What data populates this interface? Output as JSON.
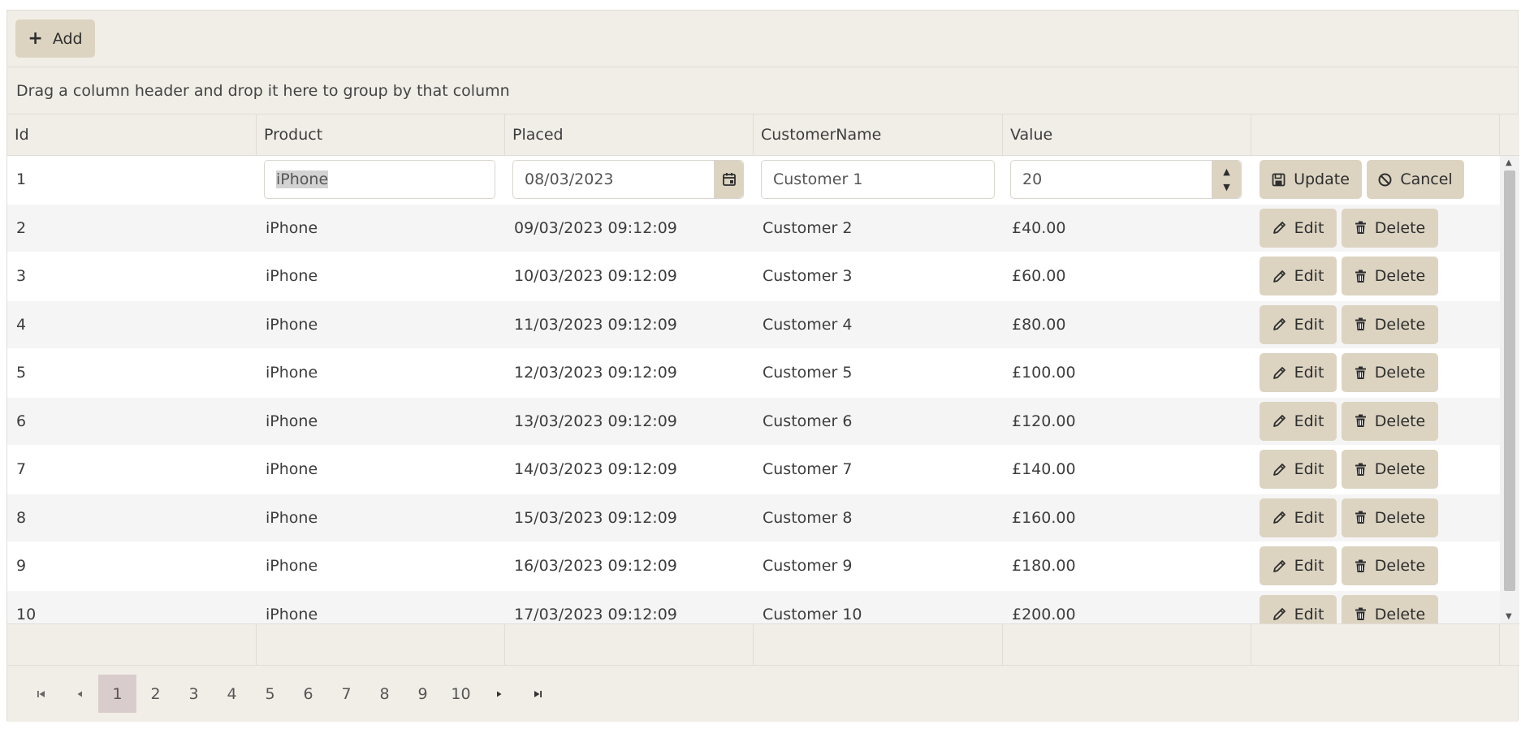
{
  "toolbar": {
    "add_label": "Add"
  },
  "group_panel": {
    "hint": "Drag a column header and drop it here to group by that column"
  },
  "columns": [
    "Id",
    "Product",
    "Placed",
    "CustomerName",
    "Value",
    ""
  ],
  "edit_row": {
    "id": "1",
    "product": "iPhone",
    "placed": "08/03/2023",
    "customer": "Customer 1",
    "value": "20",
    "update_label": "Update",
    "cancel_label": "Cancel"
  },
  "rows": [
    {
      "id": "2",
      "product": "iPhone",
      "placed": "09/03/2023 09:12:09",
      "customer": "Customer 2",
      "value": "£40.00"
    },
    {
      "id": "3",
      "product": "iPhone",
      "placed": "10/03/2023 09:12:09",
      "customer": "Customer 3",
      "value": "£60.00"
    },
    {
      "id": "4",
      "product": "iPhone",
      "placed": "11/03/2023 09:12:09",
      "customer": "Customer 4",
      "value": "£80.00"
    },
    {
      "id": "5",
      "product": "iPhone",
      "placed": "12/03/2023 09:12:09",
      "customer": "Customer 5",
      "value": "£100.00"
    },
    {
      "id": "6",
      "product": "iPhone",
      "placed": "13/03/2023 09:12:09",
      "customer": "Customer 6",
      "value": "£120.00"
    },
    {
      "id": "7",
      "product": "iPhone",
      "placed": "14/03/2023 09:12:09",
      "customer": "Customer 7",
      "value": "£140.00"
    },
    {
      "id": "8",
      "product": "iPhone",
      "placed": "15/03/2023 09:12:09",
      "customer": "Customer 8",
      "value": "£160.00"
    },
    {
      "id": "9",
      "product": "iPhone",
      "placed": "16/03/2023 09:12:09",
      "customer": "Customer 9",
      "value": "£180.00"
    },
    {
      "id": "10",
      "product": "iPhone",
      "placed": "17/03/2023 09:12:09",
      "customer": "Customer 10",
      "value": "£200.00"
    }
  ],
  "row_actions": {
    "edit_label": "Edit",
    "delete_label": "Delete"
  },
  "pager": {
    "pages": [
      "1",
      "2",
      "3",
      "4",
      "5",
      "6",
      "7",
      "8",
      "9",
      "10"
    ],
    "current": "1"
  },
  "colors": {
    "accent": "#dcd4c1",
    "header_bg": "#f1eee7",
    "current_page": "#d9cccc",
    "alt_row": "#f5f5f5"
  },
  "icons": {
    "add": "plus-icon",
    "date": "calendar-icon",
    "update": "save-icon",
    "cancel": "cancel-icon",
    "edit": "pencil-icon",
    "delete": "trash-icon"
  }
}
